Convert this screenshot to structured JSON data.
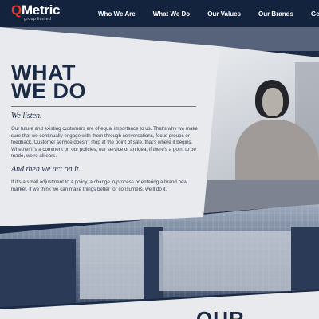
{
  "header": {
    "logo": {
      "letter": "Q",
      "rest": "Metric",
      "sub": "group limited"
    },
    "nav": [
      "Who We Are",
      "What We Do",
      "Our Values",
      "Our Brands",
      "Get In T"
    ]
  },
  "content": {
    "heading_line1": "WHAT",
    "heading_line2": "WE DO",
    "subhead1": "We listen.",
    "para1": "Our future and existing customers are of equal importance to us. That’s why we make sure that we continually engage with them through conversations, focus groups or feedback. Customer service doesn’t stop at the point of sale, that’s where it begins. Whether it’s a comment on our policies, our service or an idea; if there’s a point to be made, we’re all ears.",
    "subhead2": "And then we act on it.",
    "para2": "If it’s a small adjustment to a policy, a change in process or entering a brand new market, if we think we can make things better for consumers, we’ll do it."
  },
  "next_section": {
    "title": "OUR"
  },
  "colors": {
    "navy": "#1b2a45",
    "accent_red": "#e23b2e",
    "panel": "#e8eaee"
  }
}
